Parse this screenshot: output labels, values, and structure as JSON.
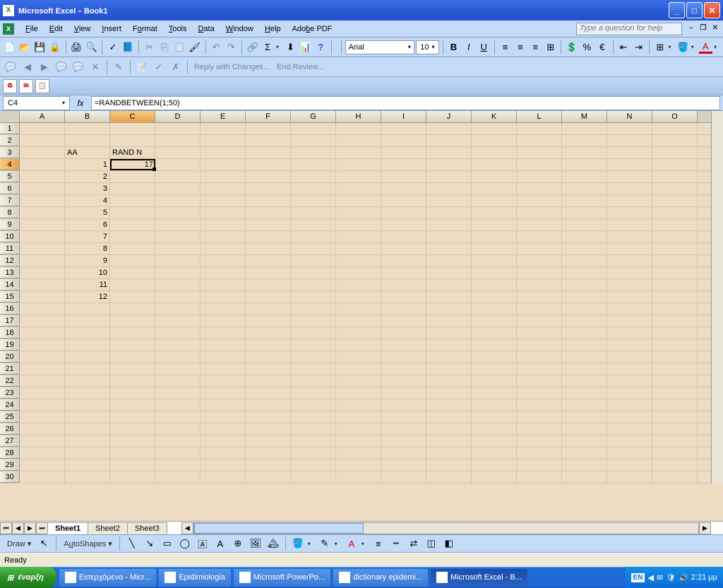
{
  "titlebar": {
    "app": "Microsoft Excel",
    "doc": "Book1"
  },
  "menu": {
    "file": "File",
    "edit": "Edit",
    "view": "View",
    "insert": "Insert",
    "format": "Format",
    "tools": "Tools",
    "data": "Data",
    "window": "Window",
    "help": "Help",
    "adobe": "Adobe PDF",
    "helpbox": "Type a question for help"
  },
  "formatting": {
    "font": "Arial",
    "size": "10"
  },
  "review": {
    "reply": "Reply with Changes...",
    "end": "End Review..."
  },
  "formula": {
    "cellref": "C4",
    "fx": "fx",
    "value": "=RANDBETWEEN(1;50)"
  },
  "columns": [
    "A",
    "B",
    "C",
    "D",
    "E",
    "F",
    "G",
    "H",
    "I",
    "J",
    "K",
    "L",
    "M",
    "N",
    "O"
  ],
  "active_col": "C",
  "active_row": 4,
  "chart_data": {
    "type": "table",
    "active_cell": "C4",
    "cells": {
      "B3": "AA",
      "C3": "RAND N",
      "B4": "1",
      "C4": "17",
      "B5": "2",
      "B6": "3",
      "B7": "4",
      "B8": "5",
      "B9": "6",
      "B10": "7",
      "B11": "8",
      "B12": "9",
      "B13": "10",
      "B14": "11",
      "B15": "12"
    }
  },
  "sheets": {
    "s1": "Sheet1",
    "s2": "Sheet2",
    "s3": "Sheet3"
  },
  "draw": {
    "label": "Draw",
    "autoshapes": "AutoShapes"
  },
  "status": {
    "ready": "Ready"
  },
  "taskbar": {
    "start": "έναρξη",
    "items": [
      "Εισερχόμενα - Micr...",
      "Epidimiologia",
      "Microsoft PowerPo...",
      "dictionary epidemi...",
      "Microsoft Excel - B..."
    ],
    "lang": "EN",
    "time": "2:21 μμ"
  }
}
